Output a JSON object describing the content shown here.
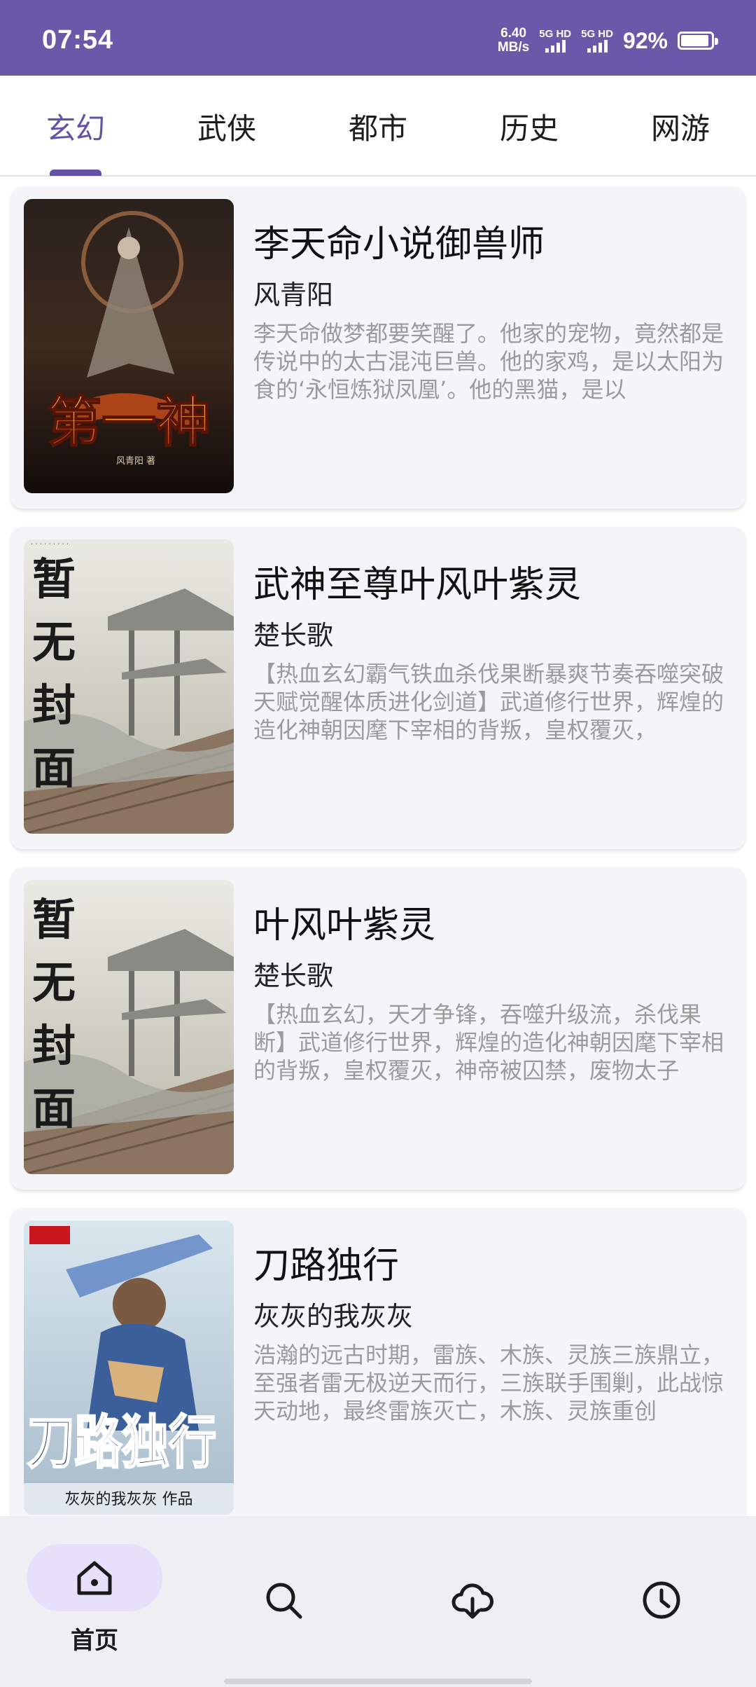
{
  "status_bar": {
    "time": "07:54",
    "speed_value": "6.40",
    "speed_unit": "MB/s",
    "sim1_label": "5G HD",
    "sim2_label": "5G HD",
    "battery_percent": "92%",
    "battery_level": 0.92,
    "bg_color": "#6a58a8"
  },
  "tabs": [
    {
      "label": "玄幻",
      "active": true
    },
    {
      "label": "武侠",
      "active": false
    },
    {
      "label": "都市",
      "active": false
    },
    {
      "label": "历史",
      "active": false
    },
    {
      "label": "网游",
      "active": false
    }
  ],
  "accent_color": "#6452a6",
  "books": [
    {
      "title": "李天命小说御兽师",
      "author": "风青阳",
      "description": "李天命做梦都要笑醒了。他家的宠物，竟然都是传说中的太古混沌巨兽。他的家鸡，是以太阳为食的‘永恒炼狱凤凰’。他的黑猫，是以",
      "cover_title": "第一神",
      "cover_author": "风青阳 著"
    },
    {
      "title": "武神至尊叶风叶紫灵",
      "author": "楚长歌",
      "description": "【热血玄幻霸气铁血杀伐果断暴爽节奏吞噬突破天赋觉醒体质进化剑道】武道修行世界，辉煌的造化神朝因麾下宰相的背叛，皇权覆灭，",
      "cover_title": "暂无封面"
    },
    {
      "title": "叶风叶紫灵",
      "author": "楚长歌",
      "description": "【热血玄幻，天才争锋，吞噬升级流，杀伐果断】武道修行世界，辉煌的造化神朝因麾下宰相的背叛，皇权覆灭，神帝被囚禁，废物太子",
      "cover_title": "暂无封面"
    },
    {
      "title": "刀路独行",
      "author": "灰灰的我灰灰",
      "description": "浩瀚的远古时期，雷族、木族、灵族三族鼎立，至强者雷无极逆天而行，三族联手围剿，此战惊天动地，最终雷族灭亡，木族、灵族重创",
      "cover_title": "刀路独行",
      "cover_author": "灰灰的我灰灰 作品"
    }
  ],
  "bottom_nav": [
    {
      "label": "首页",
      "icon": "home-icon",
      "active": true
    },
    {
      "label": "",
      "icon": "search-icon",
      "active": false
    },
    {
      "label": "",
      "icon": "download-icon",
      "active": false
    },
    {
      "label": "",
      "icon": "history-icon",
      "active": false
    }
  ]
}
